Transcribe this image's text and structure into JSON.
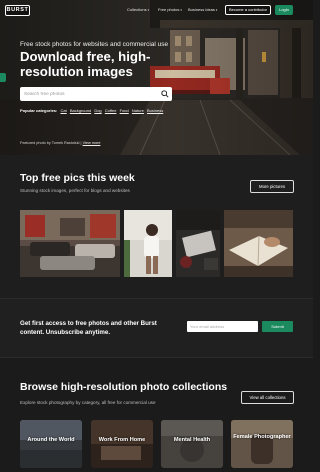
{
  "nav": {
    "logo": "BURST",
    "links": [
      "Collections",
      "Free photos",
      "Business ideas",
      "Sell online"
    ],
    "contribute": "Become a contributor",
    "login": "Login"
  },
  "hero": {
    "eyebrow": "Free stock photos for websites and commercial use",
    "title": "Download free, high-resolution images",
    "search_placeholder": "Search free photos",
    "popular_label": "Popular categories:",
    "popular_tags": [
      "Cat",
      "Background",
      "Dog",
      "Coffee",
      "Food",
      "Nature",
      "Business"
    ],
    "featured_prefix": "Featured photo by Tomek Rastolski |",
    "featured_link": "View more"
  },
  "top": {
    "title": "Top free pics this week",
    "subtitle": "Stunning stock images, perfect for blogs and websites",
    "more_button": "More pictures"
  },
  "subscribe": {
    "text": "Get first access to free photos and other Burst content. Unsubscribe anytime.",
    "email_placeholder": "Your email address",
    "submit": "Submit"
  },
  "collections": {
    "title": "Browse high-resolution photo collections",
    "subtitle": "Explore stock photography by category, all free for commercial use",
    "all_button": "View all collections",
    "cards": [
      {
        "label": "Around the World"
      },
      {
        "label": "Work From Home"
      },
      {
        "label": "Mental Health"
      },
      {
        "label": "Female Photographer"
      }
    ]
  },
  "colors": {
    "accent": "#1c8a5f",
    "background": "#1b1b1b"
  }
}
